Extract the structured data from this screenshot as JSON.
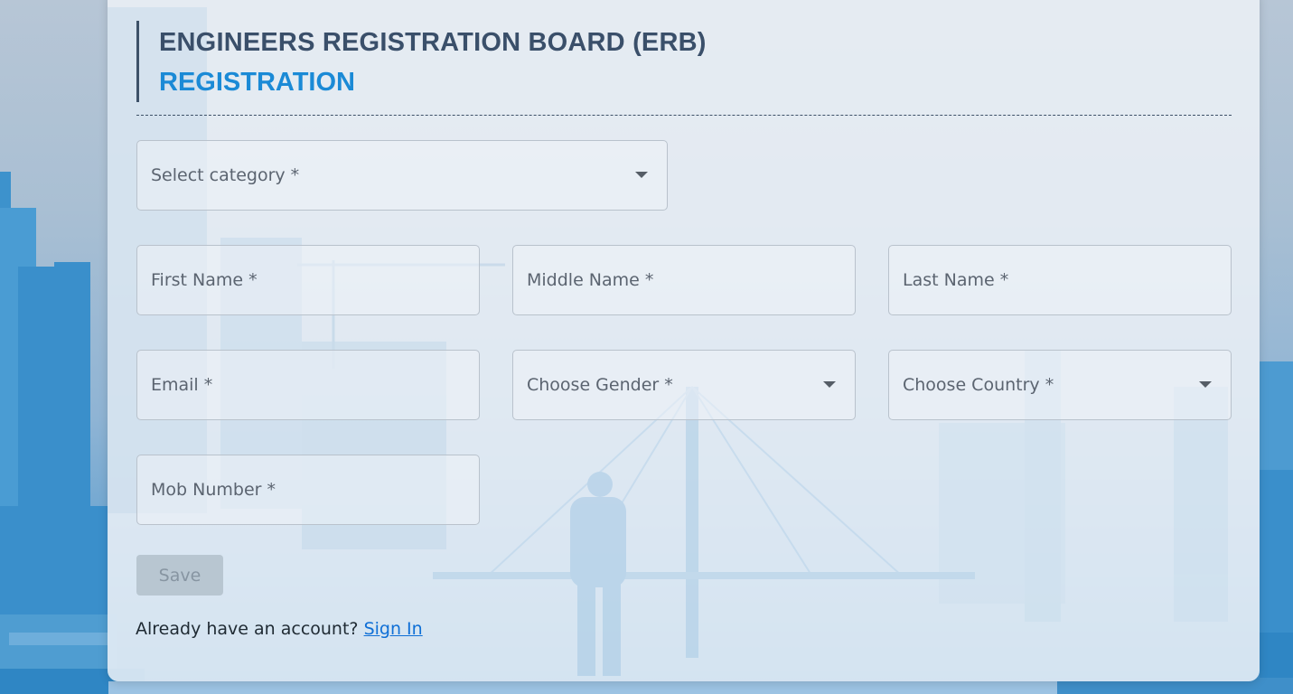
{
  "header": {
    "org_title": "ENGINEERS REGISTRATION BOARD (ERB)",
    "page_title": "REGISTRATION"
  },
  "form": {
    "category": {
      "placeholder": "Select category *",
      "icon": "chevron-down-icon"
    },
    "first_name": {
      "placeholder": "First Name *"
    },
    "middle_name": {
      "placeholder": "Middle Name *"
    },
    "last_name": {
      "placeholder": "Last Name *"
    },
    "email": {
      "placeholder": "Email *"
    },
    "gender": {
      "placeholder": "Choose Gender *",
      "icon": "chevron-down-icon"
    },
    "country": {
      "placeholder": "Choose Country *",
      "icon": "chevron-down-icon"
    },
    "mobile": {
      "placeholder": "Mob Number *"
    },
    "save_label": "Save"
  },
  "footer": {
    "prompt": "Already have an account?",
    "signin_label": "Sign In"
  },
  "colors": {
    "title": "#3a4f6a",
    "subtitle": "#1b8ad6",
    "link": "#0f6fd6",
    "save_disabled_bg": "#b8c6d1"
  }
}
